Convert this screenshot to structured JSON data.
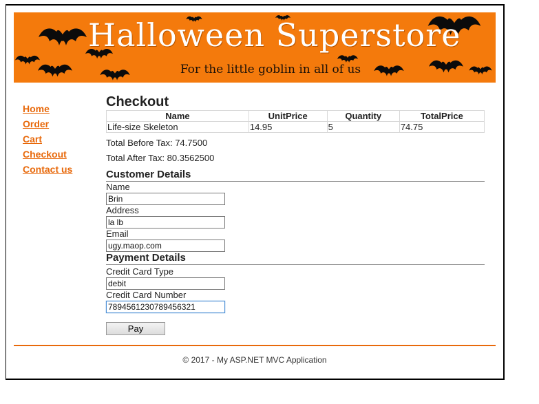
{
  "banner": {
    "title": "Halloween Superstore",
    "subtitle": "For the little goblin in all of us"
  },
  "nav": {
    "items": [
      {
        "label": "Home"
      },
      {
        "label": "Order"
      },
      {
        "label": "Cart"
      },
      {
        "label": "Checkout"
      },
      {
        "label": "Contact us"
      }
    ]
  },
  "main": {
    "title": "Checkout",
    "table": {
      "headers": [
        "Name",
        "UnitPrice",
        "Quantity",
        "TotalPrice"
      ],
      "rows": [
        [
          "Life-size Skeleton",
          "14.95",
          "5",
          "74.75"
        ]
      ]
    },
    "total_before_tax": "Total Before Tax: 74.7500",
    "total_after_tax": "Total After Tax: 80.3562500",
    "customer": {
      "heading": "Customer Details",
      "name_label": "Name",
      "name_value": "Brin",
      "address_label": "Address",
      "address_value": "la lb",
      "email_label": "Email",
      "email_value": "ugy.maop.com"
    },
    "payment": {
      "heading": "Payment Details",
      "card_type_label": "Credit Card Type",
      "card_type_value": "debit",
      "card_number_label": "Credit Card Number",
      "card_number_value": "7894561230789456321"
    },
    "pay_label": "Pay"
  },
  "footer": {
    "text": "© 2017 - My ASP.NET MVC Application"
  },
  "colors": {
    "accent": "#e8690b",
    "banner_bg": "#f47a0c"
  }
}
